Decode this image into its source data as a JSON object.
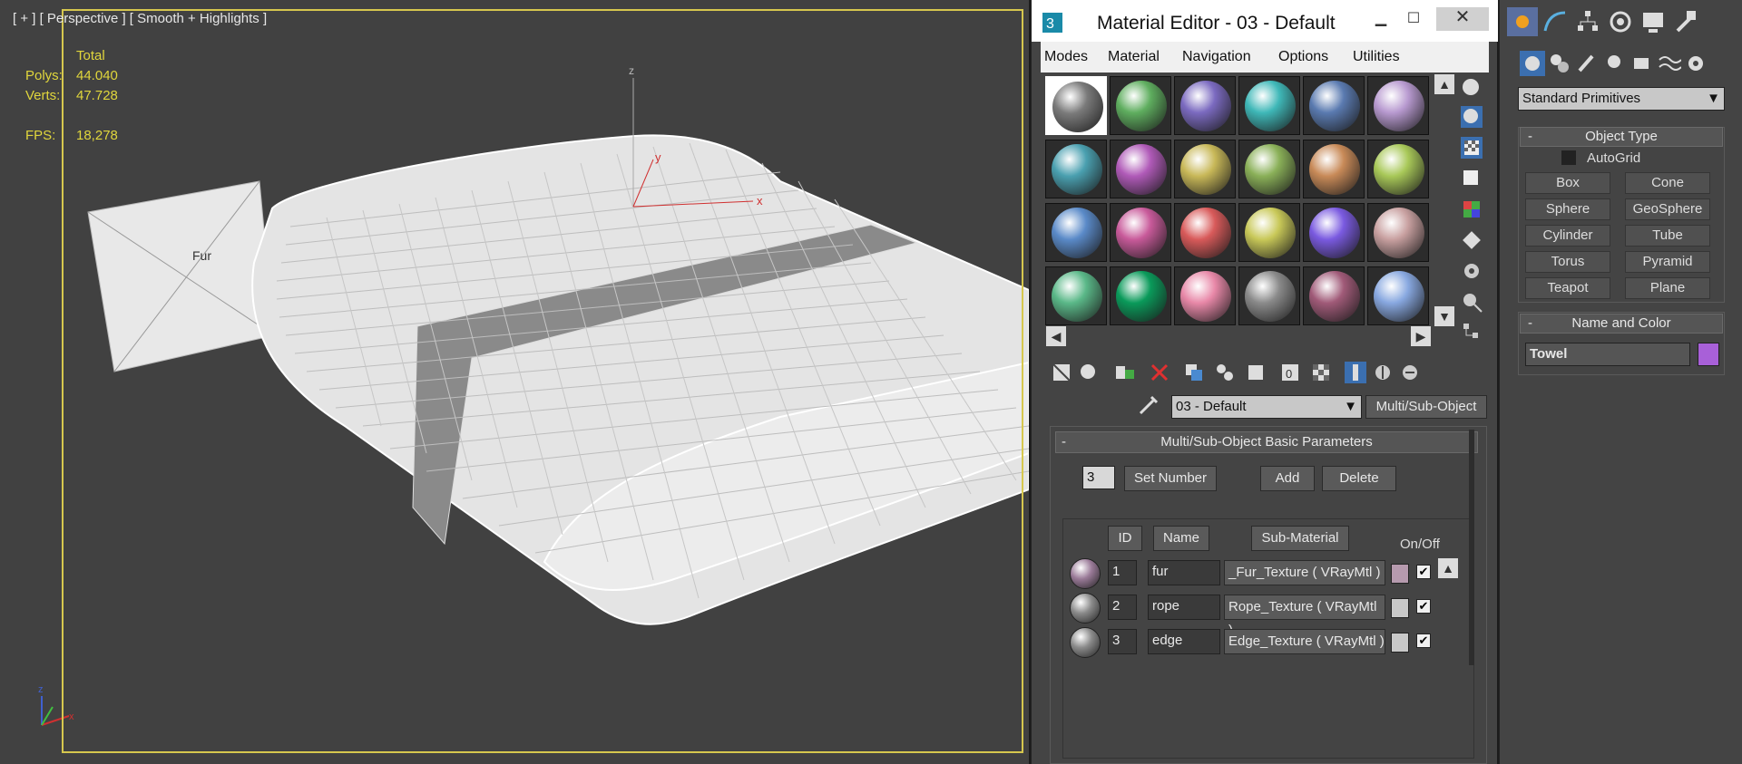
{
  "viewport": {
    "label": "[ + ] [ Perspective ] [ Smooth + Highlights ]",
    "stats": {
      "total_label": "Total",
      "polys_label": "Polys:",
      "polys_value": "44.040",
      "verts_label": "Verts:",
      "verts_value": "47.728",
      "fps_label": "FPS:",
      "fps_value": "18,278"
    },
    "fur_label": "Fur",
    "gizmo": {
      "x": "x",
      "y": "y",
      "z": "z"
    }
  },
  "material_editor": {
    "title": "Material Editor - 03 - Default",
    "menu": [
      "Modes",
      "Material",
      "Navigation",
      "Options",
      "Utilities"
    ],
    "slot_colors": [
      "#7a7a7a",
      "#5fae5f",
      "#7b6ac0",
      "#3fb8b8",
      "#5a7ab0",
      "#b89ad0",
      "#4aa0b0",
      "#b05ab8",
      "#c8b858",
      "#8ab058",
      "#c88a58",
      "#a8c858",
      "#5a8ac8",
      "#c85a9a",
      "#d85a5a",
      "#c8c858",
      "#7a5ae0",
      "#c8a0a0",
      "#5ab888",
      "#0a9a5a",
      "#e888a8",
      "#8a8a8a",
      "#a05a78",
      "#88a8e0"
    ],
    "material_name": "03 - Default",
    "material_type": "Multi/Sub-Object",
    "rollout_title": "Multi/Sub-Object Basic Parameters",
    "collapse_sign": "-",
    "count_value": "3",
    "set_number": "Set Number",
    "add": "Add",
    "delete": "Delete",
    "headers": {
      "id": "ID",
      "name": "Name",
      "sub_material": "Sub-Material",
      "onoff": "On/Off"
    },
    "rows": [
      {
        "id": "1",
        "name": "fur",
        "sub": "_Fur_Texture  ( VRayMtl )",
        "swatch": "#b69aae",
        "ball": "#9a7a98"
      },
      {
        "id": "2",
        "name": "rope",
        "sub": "Rope_Texture  ( VRayMtl )",
        "swatch": "#c8c8c8",
        "ball": "#8a8a8a"
      },
      {
        "id": "3",
        "name": "edge",
        "sub": "Edge_Texture  ( VRayMtl )",
        "swatch": "#c8c8c8",
        "ball": "#8a8a8a"
      }
    ],
    "check": "✔"
  },
  "command_panel": {
    "category": "Standard Primitives",
    "object_type_title": "Object Type",
    "autogrid": "AutoGrid",
    "buttons": [
      "Box",
      "Cone",
      "Sphere",
      "GeoSphere",
      "Cylinder",
      "Tube",
      "Torus",
      "Pyramid",
      "Teapot",
      "Plane"
    ],
    "name_color_title": "Name and Color",
    "object_name": "Towel",
    "object_color": "#a860d8",
    "collapse_sign": "-"
  }
}
